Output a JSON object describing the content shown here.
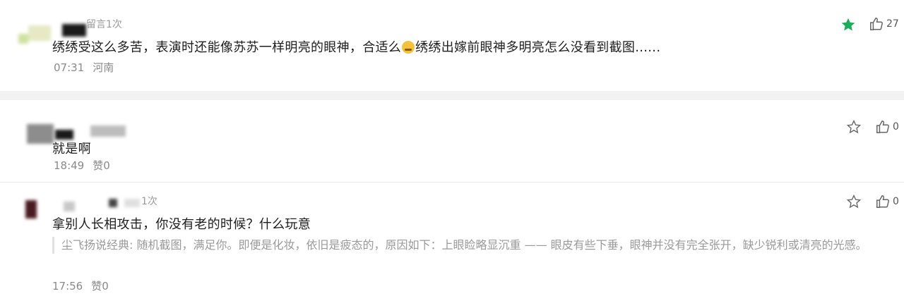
{
  "comments": [
    {
      "username_hint": "留言1次",
      "text_before_emoji": "绣绣受这么多苦，表演时还能像苏苏一样明亮的眼神，合适么",
      "text_after_emoji": "绣绣出嫁前眼神多明亮怎么没看到截图......",
      "time": "07:31",
      "location": "河南",
      "like_count": "27",
      "starred": true
    },
    {
      "text": "就是啊",
      "time": "18:49",
      "like_label": "赞0",
      "like_count": "0"
    },
    {
      "username_hint": "1次",
      "text": "拿别人长相攻击，你没有老的时候？什么玩意",
      "quote": "尘飞扬说经典: 随机截图，满足你。即便是化妆，依旧是疲态的，原因如下：上眼睑略显沉重 —— 眼皮有些下垂，眼神并没有完全张开，缺少锐利或清亮的光感。",
      "time": "17:56",
      "like_label": "赞0",
      "like_count": "0"
    }
  ],
  "icons": {
    "star_filled": "star-filled-icon",
    "star_outline": "star-outline-icon",
    "thumbs_up": "thumbs-up-icon"
  },
  "colors": {
    "accent_green": "#1aad5a",
    "meta_gray": "#8a8a8a"
  }
}
